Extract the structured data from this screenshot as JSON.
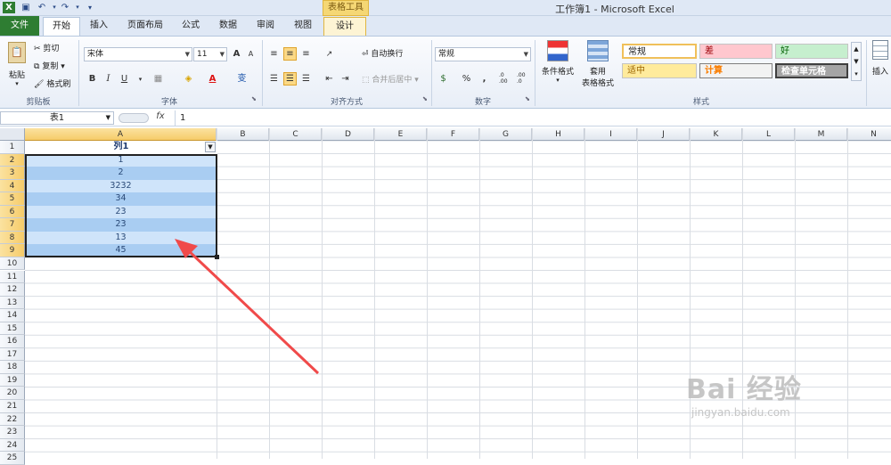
{
  "window": {
    "title": "工作簿1 - Microsoft Excel",
    "context_tools": "表格工具"
  },
  "tabs": {
    "file": "文件",
    "home": "开始",
    "insert": "插入",
    "page_layout": "页面布局",
    "formulas": "公式",
    "data": "数据",
    "review": "审阅",
    "view": "视图",
    "design": "设计"
  },
  "ribbon": {
    "clipboard": {
      "paste": "粘贴",
      "cut": "剪切",
      "copy": "复制",
      "format_painter": "格式刷",
      "label": "剪贴板"
    },
    "font": {
      "name": "宋体",
      "size": "11",
      "bold": "B",
      "italic": "I",
      "underline": "U",
      "label": "字体",
      "grow": "A",
      "shrink": "A",
      "wen": "变"
    },
    "align": {
      "wrap": "自动换行",
      "merge": "合并后居中",
      "label": "对齐方式"
    },
    "number": {
      "format": "常规",
      "percent": "%",
      "comma": ",",
      "inc": ".0 .00",
      "dec": ".00 .0",
      "label": "数字"
    },
    "styles": {
      "conditional": "条件格式",
      "table_line1": "套用",
      "table_line2": "表格格式",
      "normal": "常规",
      "bad": "差",
      "good": "好",
      "neutral": "适中",
      "calc": "计算",
      "check": "检查单元格",
      "label": "样式"
    },
    "cells": {
      "insert": "插入"
    }
  },
  "formula_bar": {
    "name_box": "表1",
    "fx": "fx",
    "value": "1"
  },
  "columns": [
    "A",
    "B",
    "C",
    "D",
    "E",
    "F",
    "G",
    "H",
    "I",
    "J",
    "K",
    "L",
    "M",
    "N"
  ],
  "rows": [
    "1",
    "2",
    "3",
    "4",
    "5",
    "6",
    "7",
    "8",
    "9",
    "10",
    "11",
    "12",
    "13",
    "14",
    "15",
    "16",
    "17",
    "18",
    "19",
    "20",
    "21",
    "22",
    "23",
    "24",
    "25"
  ],
  "table": {
    "header": "列1",
    "values": [
      "1",
      "2",
      "3232",
      "34",
      "23",
      "23",
      "13",
      "45"
    ]
  },
  "colors": {
    "file_tab": "#2e7d32",
    "band_dark": "#a9cdf2",
    "band_light": "#cfe4fa",
    "arrow": "#f04a4a"
  },
  "watermark": {
    "text": "Bai 经验",
    "url": "jingyan.baidu.com"
  }
}
